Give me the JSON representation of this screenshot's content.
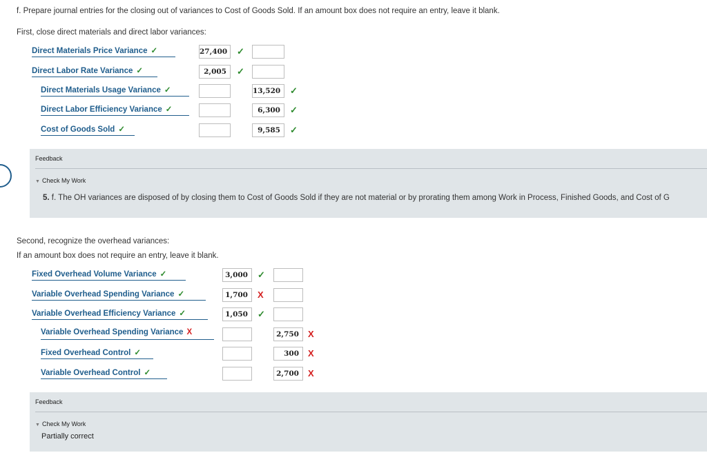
{
  "question": "f. Prepare journal entries for the closing out of variances to Cost of Goods Sold. If an amount box does not require an entry, leave it blank.",
  "section1": {
    "instruction": "First, close direct materials and direct labor variances:",
    "rows": [
      {
        "account": "Direct Materials Price Variance",
        "account_mark": "✓",
        "debit": "27,400",
        "debit_mark": "✓",
        "credit": "",
        "credit_mark": ""
      },
      {
        "account": "Direct Labor Rate Variance",
        "account_mark": "✓",
        "debit": "2,005",
        "debit_mark": "✓",
        "credit": "",
        "credit_mark": ""
      },
      {
        "account": "Direct Materials Usage Variance",
        "account_mark": "✓",
        "debit": "",
        "debit_mark": "",
        "credit": "13,520",
        "credit_mark": "✓"
      },
      {
        "account": "Direct Labor Efficiency Variance",
        "account_mark": "✓",
        "debit": "",
        "debit_mark": "",
        "credit": "6,300",
        "credit_mark": "✓"
      },
      {
        "account": "Cost of Goods Sold",
        "account_mark": "✓",
        "debit": "",
        "debit_mark": "",
        "credit": "9,585",
        "credit_mark": "✓"
      }
    ],
    "feedback": {
      "title": "Feedback",
      "check_label": "Check My Work",
      "text_num": "5.",
      "text": " f. The OH variances are disposed of by closing them to Cost of Goods Sold if they are not material or by prorating them among Work in Process, Finished Goods, and Cost of G"
    }
  },
  "section2": {
    "instruction1": "Second, recognize the overhead variances:",
    "instruction2": "If an amount box does not require an entry, leave it blank.",
    "rows": [
      {
        "account": "Fixed Overhead Volume Variance",
        "account_mark": "✓",
        "debit": "3,000",
        "debit_mark": "✓",
        "credit": "",
        "credit_mark": ""
      },
      {
        "account": "Variable Overhead Spending Variance",
        "account_mark": "✓",
        "debit": "1,700",
        "debit_mark": "X",
        "credit": "",
        "credit_mark": ""
      },
      {
        "account": "Variable Overhead Efficiency Variance",
        "account_mark": "✓",
        "debit": "1,050",
        "debit_mark": "✓",
        "credit": "",
        "credit_mark": ""
      },
      {
        "account": "Variable Overhead Spending Variance",
        "account_mark": "X",
        "debit": "",
        "debit_mark": "",
        "credit": "2,750",
        "credit_mark": "X"
      },
      {
        "account": "Fixed Overhead Control",
        "account_mark": "✓",
        "debit": "",
        "debit_mark": "",
        "credit": "300",
        "credit_mark": "X"
      },
      {
        "account": "Variable Overhead Control",
        "account_mark": "✓",
        "debit": "",
        "debit_mark": "",
        "credit": "2,700",
        "credit_mark": "X"
      }
    ],
    "feedback": {
      "title": "Feedback",
      "check_label": "Check My Work",
      "status": "Partially correct"
    }
  },
  "colors": {
    "link": "#1f5d8c",
    "correct": "#2e8b2e",
    "incorrect": "#d42020",
    "feedback_bg": "#e0e5e8"
  }
}
